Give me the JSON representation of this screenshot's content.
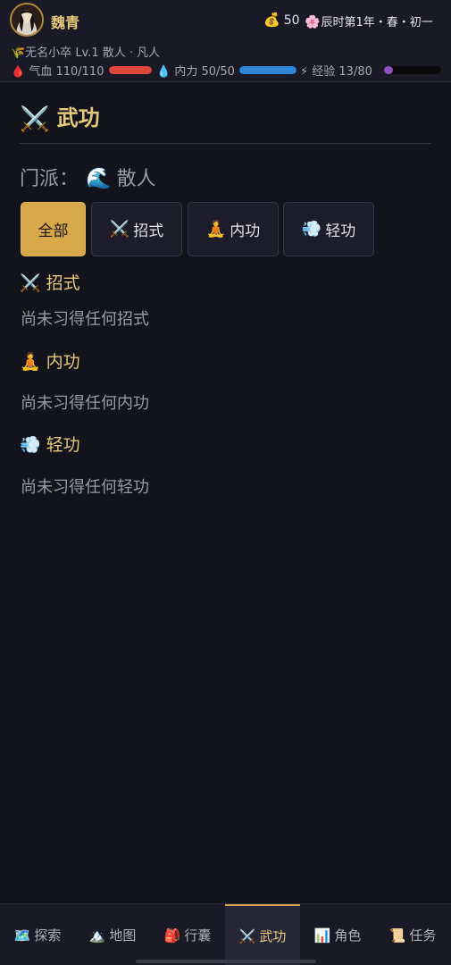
{
  "player": {
    "name": "魏青",
    "title_line": "🌾无名小卒 Lv.1 散人 · 凡人"
  },
  "wallet": {
    "icon": "money-bag-icon",
    "glyph": "💰",
    "amount": "50"
  },
  "time": {
    "icon": "blossom-icon",
    "glyph": "🌸",
    "text": "辰时第1年・春・初一"
  },
  "stats": {
    "hp": {
      "glyph": "🩸",
      "text": "气血 110/110",
      "fraction": 1.0,
      "color": "#e0483f"
    },
    "mp": {
      "glyph": "💧",
      "text": "内力 50/50",
      "fraction": 1.0,
      "color": "#2f86d6"
    },
    "exp": {
      "glyph": "⚡",
      "text": "经验 13/80",
      "fraction": 0.1625,
      "color": "#8e4fc2"
    }
  },
  "page": {
    "title_glyph": "⚔️",
    "title": "武功",
    "sect_label": "门派：",
    "sect_glyph": "🌊",
    "sect_value": "散人"
  },
  "tabs": [
    {
      "glyph": "",
      "label": "全部",
      "active": true
    },
    {
      "glyph": "⚔️",
      "label": "招式",
      "active": false
    },
    {
      "glyph": "🧘",
      "label": "内功",
      "active": false
    },
    {
      "glyph": "💨",
      "label": "轻功",
      "active": false
    }
  ],
  "groups": [
    {
      "glyph": "⚔️",
      "title": "招式",
      "empty_text": "尚未习得任何招式"
    },
    {
      "glyph": "🧘",
      "title": "内功",
      "empty_text": "尚未习得任何内功"
    },
    {
      "glyph": "💨",
      "title": "轻功",
      "empty_text": "尚未习得任何轻功"
    }
  ],
  "nav": [
    {
      "glyph": "🗺️",
      "label": "探索",
      "active": false
    },
    {
      "glyph": "🏔️",
      "label": "地图",
      "active": false
    },
    {
      "glyph": "🎒",
      "label": "行囊",
      "active": false
    },
    {
      "glyph": "⚔️",
      "label": "武功",
      "active": true
    },
    {
      "glyph": "📊",
      "label": "角色",
      "active": false
    },
    {
      "glyph": "📜",
      "label": "任务",
      "active": false
    }
  ],
  "colors": {
    "accent": "#d6a84a",
    "title": "#e7c97a",
    "background": "#13131b"
  }
}
